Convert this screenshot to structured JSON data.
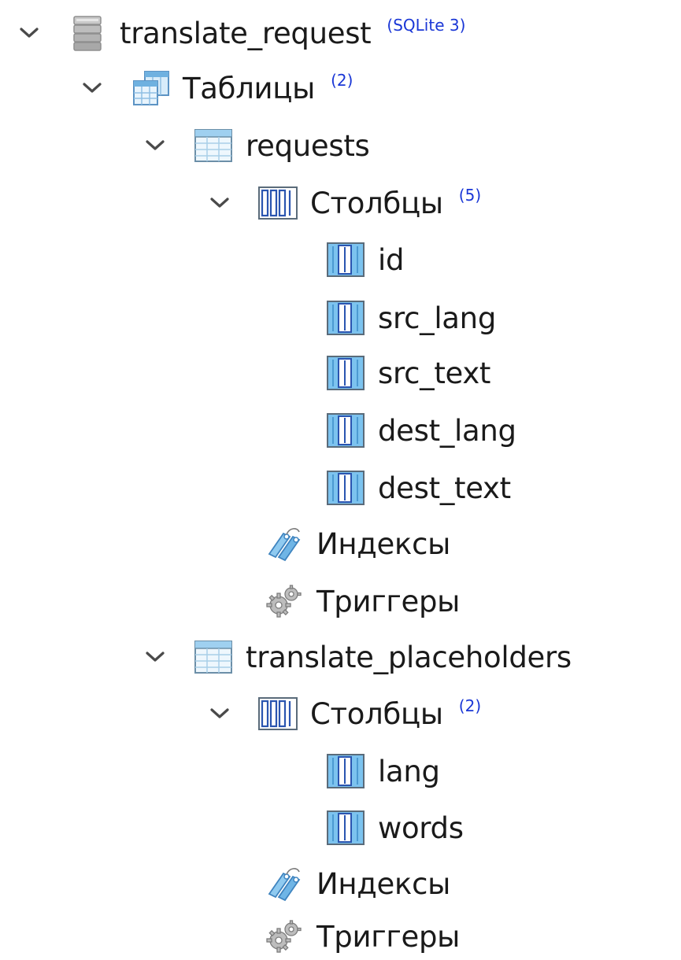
{
  "tree": {
    "database": {
      "name": "translate_request",
      "badge": "(SQLite 3)"
    },
    "tables_group": {
      "label": "Таблицы",
      "count": "(2)"
    },
    "tables": [
      {
        "name": "requests",
        "columns_label": "Столбцы",
        "columns_count": "(5)",
        "columns": [
          "id",
          "src_lang",
          "src_text",
          "dest_lang",
          "dest_text"
        ],
        "indexes_label": "Индексы",
        "triggers_label": "Триггеры"
      },
      {
        "name": "translate_placeholders",
        "columns_label": "Столбцы",
        "columns_count": "(2)",
        "columns": [
          "lang",
          "words"
        ],
        "indexes_label": "Индексы",
        "triggers_label": "Триггеры"
      }
    ]
  },
  "colors": {
    "count_badge": "#1a37d6",
    "chevron": "#4a4a4a",
    "table_icon": "#6fb1e0",
    "column_icon": "#2a78c8",
    "index_icon": "#4fa3dc",
    "trigger_icon": "#9a9a9a",
    "database_icon": "#b0b0b0"
  },
  "icons": {
    "chevron": "chevron-down-icon",
    "database": "database-icon",
    "tables_group": "tables-group-icon",
    "table": "table-icon",
    "columns_group": "columns-group-icon",
    "column": "column-icon",
    "indexes": "index-icon",
    "triggers": "trigger-gears-icon"
  }
}
